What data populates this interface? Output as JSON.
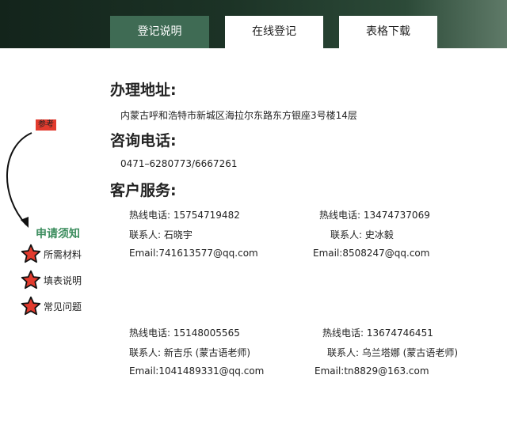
{
  "tabs": [
    {
      "label": "登记说明",
      "active": true
    },
    {
      "label": "在线登记",
      "active": false
    },
    {
      "label": "表格下载",
      "active": false
    }
  ],
  "address": {
    "heading": "办理地址:",
    "text": "内蒙古呼和浩特市新城区海拉尔东路东方银座3号楼14层"
  },
  "phone": {
    "heading": "咨询电话:",
    "text": "0471–6280773/6667261"
  },
  "service": {
    "heading": "客户服务:",
    "contacts": [
      {
        "hotline": "热线电话: 15754719482",
        "person": "联系人: 石晓宇",
        "email": "Email:741613577@qq.com"
      },
      {
        "hotline": "热线电话: 13474737069",
        "person": "联系人: 史冰毅",
        "email": "Email:8508247@qq.com"
      },
      {
        "hotline": "热线电话: 15148005565",
        "person": "联系人: 新吉乐 (蒙古语老师)",
        "email": "Email:1041489331@qq.com"
      },
      {
        "hotline": "热线电话: 13674746451",
        "person": "联系人: 乌兰塔娜 (蒙古语老师)",
        "email": "Email:tn8829@163.com"
      }
    ]
  },
  "sidebar": {
    "tag": "参考",
    "title": "申请须知",
    "items": [
      {
        "label": "所需材料",
        "icon": "star-icon"
      },
      {
        "label": "填表说明",
        "icon": "star-icon"
      },
      {
        "label": "常见问题",
        "icon": "star-icon"
      }
    ]
  },
  "colors": {
    "header_dark": "#1c3326",
    "tab_active": "#3f6b54",
    "accent_green": "#3c8d5e",
    "star_red": "#e23b2e",
    "tag_red": "#e23b2e"
  }
}
